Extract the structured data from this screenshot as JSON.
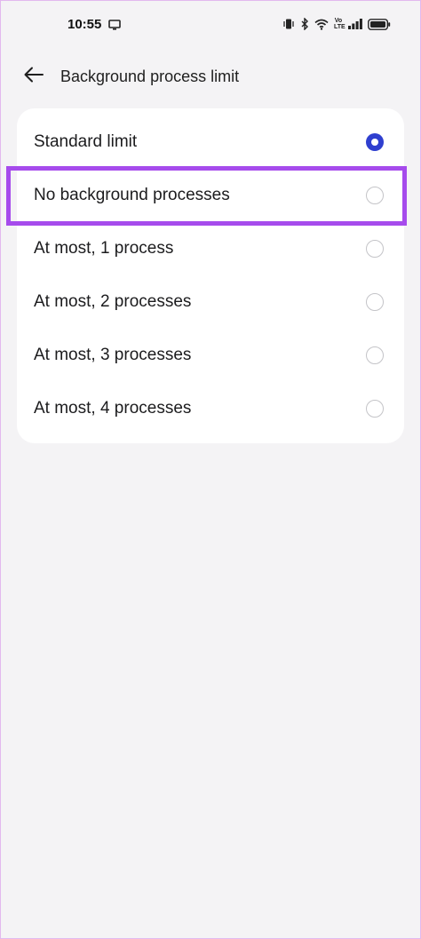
{
  "status_bar": {
    "time": "10:55",
    "volte_label_top": "Vo",
    "volte_label_bottom": "LTE",
    "icons": [
      "screen-cast-icon",
      "vibrate-icon",
      "bluetooth-icon",
      "wifi-icon",
      "volte-icon",
      "signal-icon",
      "battery-icon"
    ]
  },
  "header": {
    "back_icon": "arrow-left-icon",
    "title": "Background process limit"
  },
  "options": [
    {
      "label": "Standard limit",
      "selected": true
    },
    {
      "label": "No background processes",
      "selected": false,
      "highlighted": true
    },
    {
      "label": "At most, 1 process",
      "selected": false
    },
    {
      "label": "At most, 2 processes",
      "selected": false
    },
    {
      "label": "At most, 3 processes",
      "selected": false
    },
    {
      "label": "At most, 4 processes",
      "selected": false
    }
  ],
  "colors": {
    "accent": "#2f3fcf",
    "highlight": "#a64bec",
    "background": "#f4f3f5",
    "card": "#ffffff"
  }
}
